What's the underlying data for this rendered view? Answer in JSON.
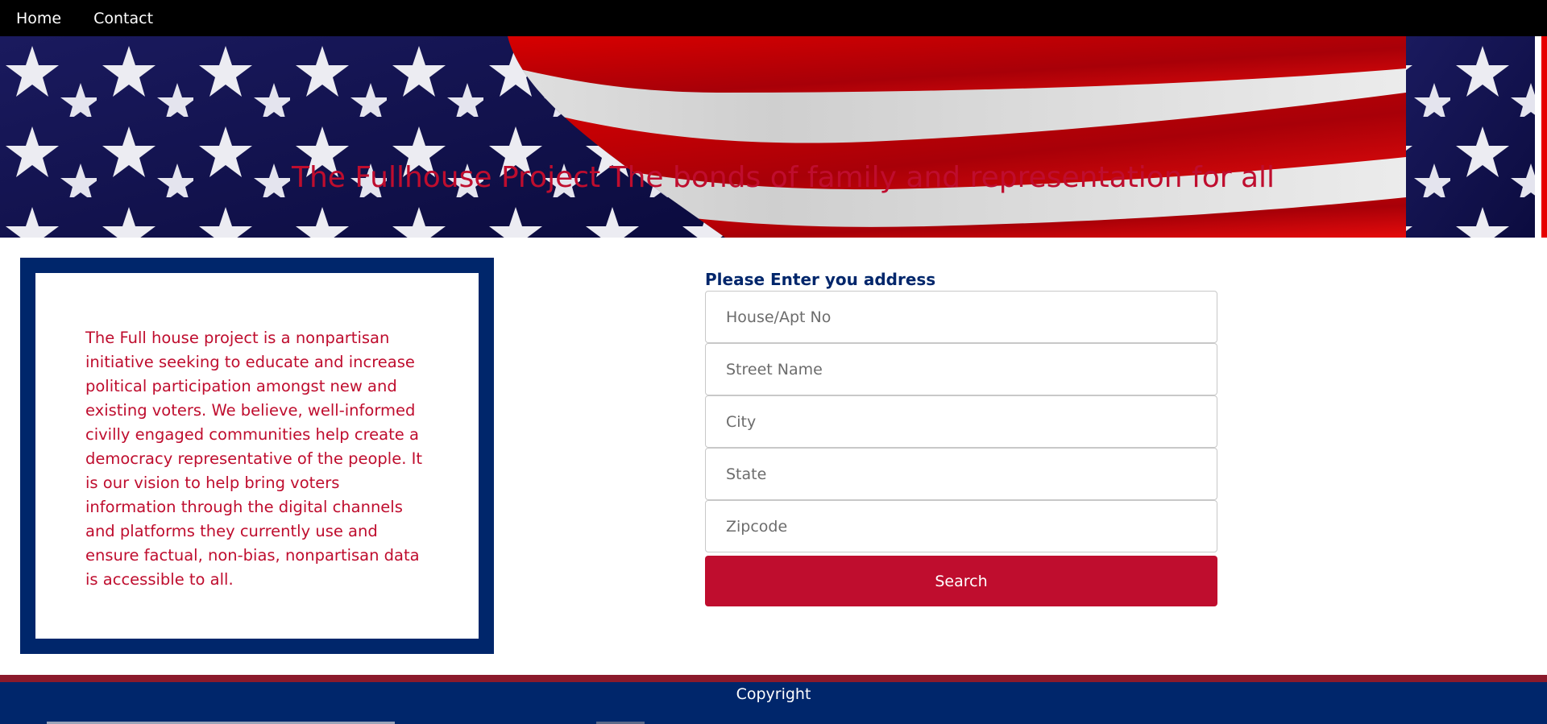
{
  "nav": {
    "items": [
      {
        "label": "Home"
      },
      {
        "label": "Contact"
      }
    ]
  },
  "hero": {
    "title": "The Fullhouse Project The bonds of family and representation for all"
  },
  "about": {
    "text": "The Full house project is a nonpartisan initiative seeking to educate and increase political participation amongst new and existing voters. We believe, well-informed civilly engaged communities help create a democracy representative of the people. It is our vision to help bring voters information through the digital channels and platforms they currently use and ensure factual, non-bias, nonpartisan data is accessible to all."
  },
  "form": {
    "label": "Please Enter you address",
    "fields": [
      {
        "placeholder": "House/Apt No",
        "value": ""
      },
      {
        "placeholder": "Street Name",
        "value": ""
      },
      {
        "placeholder": "City",
        "value": ""
      },
      {
        "placeholder": "State",
        "value": ""
      },
      {
        "placeholder": "Zipcode",
        "value": ""
      }
    ],
    "submit_label": "Search"
  },
  "footer": {
    "text": "Copyright"
  },
  "colors": {
    "nav_bg": "#000000",
    "brand_red": "#bf0d2e",
    "brand_navy": "#00266b",
    "footer_stripe": "#8b1a2b"
  }
}
